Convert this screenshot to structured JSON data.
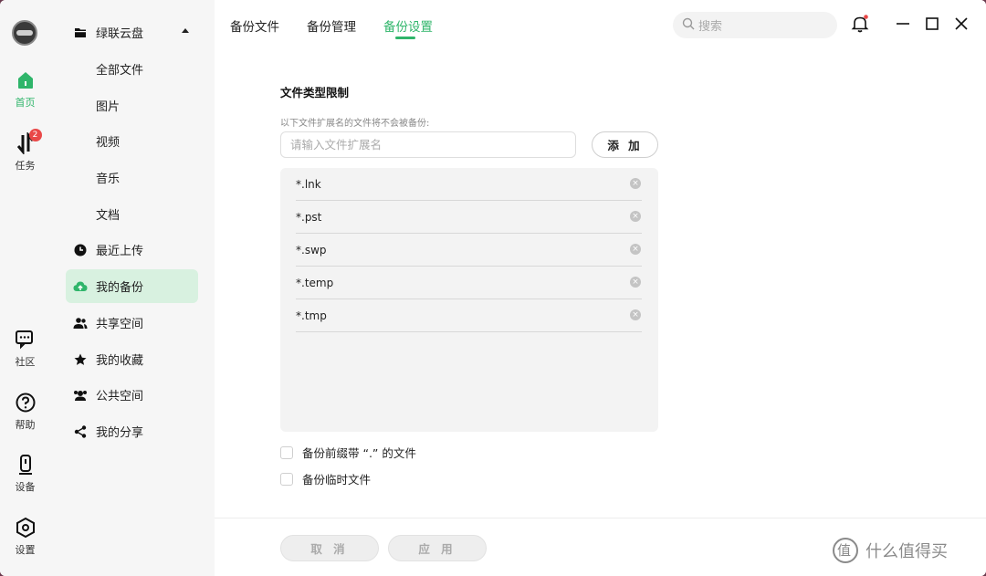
{
  "rail": {
    "items": [
      {
        "label": "首页",
        "icon": "home-icon"
      },
      {
        "label": "任务",
        "icon": "transfer-icon",
        "badge": "2"
      },
      {
        "label": "社区",
        "icon": "chat-icon"
      },
      {
        "label": "帮助",
        "icon": "help-icon"
      },
      {
        "label": "设备",
        "icon": "device-icon"
      },
      {
        "label": "设置",
        "icon": "settings-icon"
      }
    ]
  },
  "sidebar": {
    "root": "绿联云盘",
    "sub": [
      "全部文件",
      "图片",
      "视频",
      "音乐",
      "文档"
    ],
    "items": [
      {
        "label": "最近上传",
        "icon": "clock-icon"
      },
      {
        "label": "我的备份",
        "icon": "cloud-upload-icon"
      },
      {
        "label": "共享空间",
        "icon": "people-icon"
      },
      {
        "label": "我的收藏",
        "icon": "star-icon"
      },
      {
        "label": "公共空间",
        "icon": "group-icon"
      },
      {
        "label": "我的分享",
        "icon": "share-icon"
      }
    ]
  },
  "tabs": [
    "备份文件",
    "备份管理",
    "备份设置"
  ],
  "search": {
    "placeholder": "搜索"
  },
  "main": {
    "section_title": "文件类型限制",
    "hint": "以下文件扩展名的文件将不会被备份:",
    "input_placeholder": "请输入文件扩展名",
    "add_label": "添 加",
    "extensions": [
      "*.lnk",
      "*.pst",
      "*.swp",
      "*.temp",
      "*.tmp"
    ],
    "options": [
      "备份前缀带 “.” 的文件",
      "备份临时文件"
    ]
  },
  "footer": {
    "cancel": "取 消",
    "apply": "应 用"
  },
  "watermark": "什么值得买",
  "colors": {
    "accent": "#2fb56a",
    "active_bg": "#d8f1e0",
    "badge": "#e94848"
  }
}
